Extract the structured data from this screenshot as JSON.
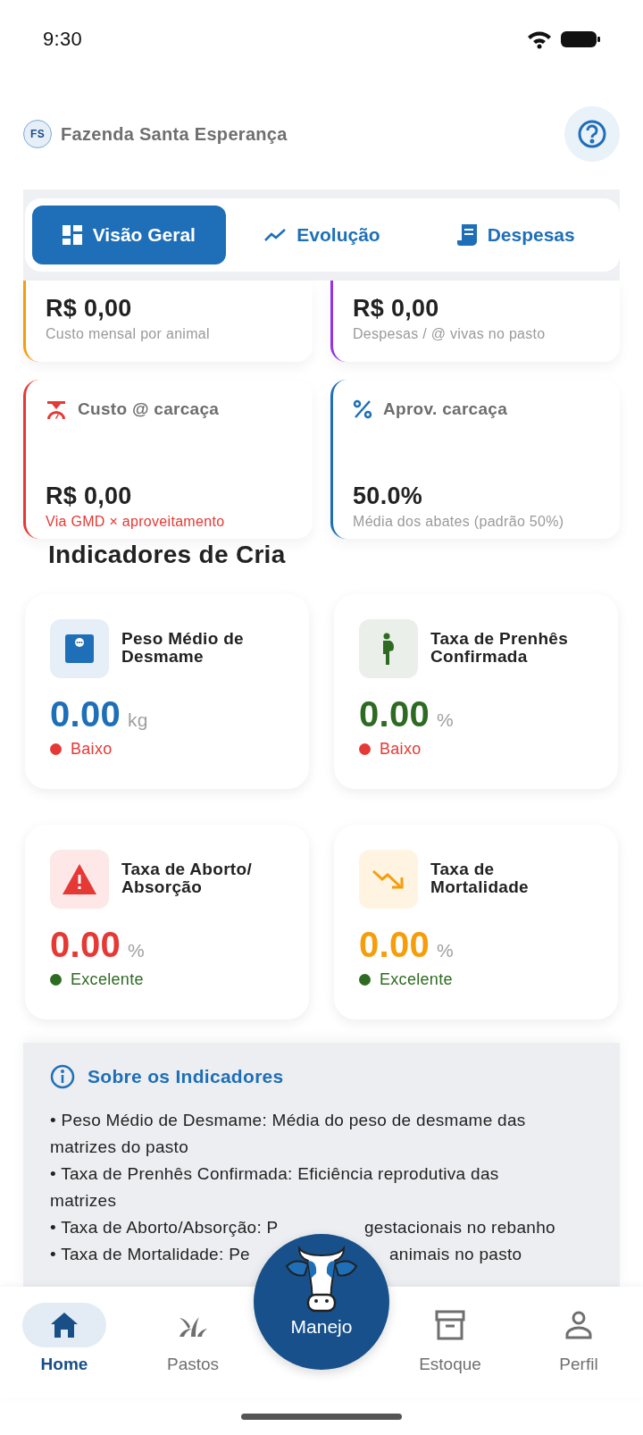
{
  "status_bar": {
    "time": "9:30"
  },
  "header": {
    "avatar": "FS",
    "farm": "Fazenda Santa Esperança"
  },
  "tabs": [
    {
      "label": "Visão Geral",
      "selected": true
    },
    {
      "label": "Evolução",
      "selected": false
    },
    {
      "label": "Despesas",
      "selected": false
    }
  ],
  "cost_cards": [
    {
      "value": "R$ 0,00",
      "caption": "Custo mensal por animal",
      "color": "#f59e0b",
      "alert": false
    },
    {
      "value": "R$ 0,00",
      "caption": "Despesas / @ vivas no pasto",
      "color": "#9333ea",
      "alert": false
    },
    {
      "label": "Custo @ carcaça",
      "value": "R$ 0,00",
      "caption": "Via GMD × aproveitamento",
      "color": "#e53935",
      "alert": true
    },
    {
      "label": "Aprov. carcaça",
      "value": "50.0%",
      "caption": "Média dos abates (padrão 50%)",
      "color": "#1e6fb8",
      "alert": false
    }
  ],
  "section_title": "Indicadores de Cria",
  "indicators": [
    {
      "title": "Peso Médio de Desmame",
      "value": "0.00",
      "unit": "kg",
      "color": "#1e6fb8",
      "status": {
        "label": "Baixo",
        "color": "#e53935"
      }
    },
    {
      "title": "Taxa de Prenhês Confirmada",
      "value": "0.00",
      "unit": "%",
      "color": "#2e6b22",
      "status": {
        "label": "Baixo",
        "color": "#e53935"
      }
    },
    {
      "title": "Taxa de Aborto/ Absorção",
      "value": "0.00",
      "unit": "%",
      "color": "#e53935",
      "status": {
        "label": "Excelente",
        "color": "#2e6b22"
      }
    },
    {
      "title": "Taxa de Mortalidade",
      "value": "0.00",
      "unit": "%",
      "color": "#f59e0b",
      "status": {
        "label": "Excelente",
        "color": "#2e6b22"
      }
    }
  ],
  "info": {
    "title": "Sobre os Indicadores",
    "lines": [
      {
        "text": "• Peso Médio de Desmame: Média do peso de desmame das matrizes do pasto"
      },
      {
        "text": "• Taxa de Prenhês Confirmada: Eficiência reprodutiva das matrizes"
      },
      {
        "text": "• Taxa de Aborto/Absorção: P",
        "after": "gestacionais no rebanho"
      },
      {
        "text": "• Taxa de Mortalidade: Pe",
        "after": "animais no pasto"
      }
    ]
  },
  "nav": [
    {
      "label": "Home",
      "selected": true
    },
    {
      "label": "Pastos",
      "selected": false
    },
    {
      "label": "Estoque",
      "selected": false
    },
    {
      "label": "Perfil",
      "selected": false
    }
  ],
  "center_action": {
    "label": "Manejo"
  }
}
